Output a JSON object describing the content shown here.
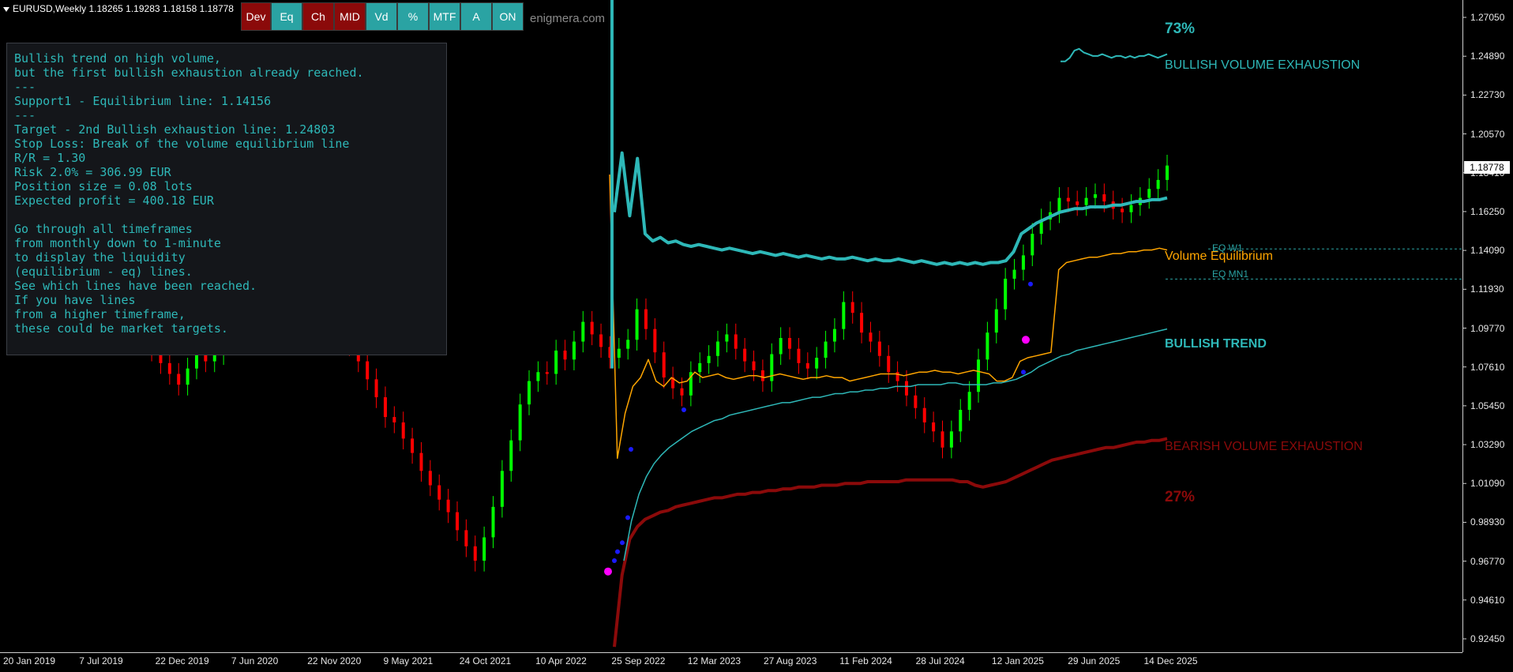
{
  "header": {
    "title": "EURUSD,Weekly  1.18265 1.19283 1.18158 1.18778"
  },
  "toolbar": {
    "buttons": [
      {
        "label": "Dev",
        "style": "red"
      },
      {
        "label": "Eq",
        "style": "teal"
      },
      {
        "label": "Ch",
        "style": "red"
      },
      {
        "label": "MID",
        "style": "red"
      },
      {
        "label": "Vd",
        "style": "teal"
      },
      {
        "label": "%",
        "style": "teal"
      },
      {
        "label": "MTF",
        "style": "teal"
      },
      {
        "label": "A",
        "style": "teal"
      },
      {
        "label": "ON",
        "style": "teal"
      }
    ],
    "site": "enigmera.com"
  },
  "info_panel": {
    "lines": [
      "Bullish trend on high volume,",
      "but the first bullish exhaustion already reached.",
      "---",
      "Support1 - Equilibrium line: 1.14156",
      "---",
      "Target - 2nd Bullish exhaustion line: 1.24803",
      "Stop Loss: Break of the volume equilibrium line",
      "R/R = 1.30",
      "Risk 2.0% = 306.99 EUR",
      "Position size = 0.08 lots",
      "Expected profit = 400.18 EUR",
      "",
      "Go through all timeframes",
      "from monthly down to 1-minute",
      "to display the liquidity",
      "(equilibrium - eq) lines.",
      "See which lines have been reached.",
      "If you have lines",
      "from a higher timeframe,",
      "these could be market targets."
    ]
  },
  "labels": {
    "bull_pct": "73%",
    "bull_exhaustion": "BULLISH VOLUME EXHAUSTION",
    "eq_w1": "EQ W1",
    "volume_equilibrium": "Volume Equilibrium",
    "eq_mn1": "EQ MN1",
    "bullish_trend": "BULLISH TREND",
    "bear_exhaustion": "BEARISH VOLUME EXHAUSTION",
    "bear_pct": "27%"
  },
  "current_price": "1.18778",
  "colors": {
    "background": "#000000",
    "teal": "#2eb8b8",
    "orange": "#ffa500",
    "dark_red": "#8b0a0a",
    "candle_up": "#00ff00",
    "candle_down": "#ff0000",
    "magenta": "#ff00ff",
    "blue_dot": "#1a1aff"
  },
  "chart_data": {
    "type": "line",
    "title": "EURUSD,Weekly",
    "ylim": [
      0.915,
      1.285
    ],
    "y_ticks": [
      "1.27050",
      "1.24890",
      "1.22730",
      "1.20570",
      "1.18410",
      "1.16250",
      "1.14090",
      "1.11930",
      "1.09770",
      "1.07610",
      "1.05450",
      "1.03290",
      "1.01090",
      "0.98930",
      "0.96770",
      "0.94610",
      "0.92450"
    ],
    "x_ticks": [
      "20 Jan 2019",
      "7 Jul 2019",
      "22 Dec 2019",
      "7 Jun 2020",
      "22 Nov 2020",
      "9 May 2021",
      "24 Oct 2021",
      "10 Apr 2022",
      "25 Sep 2022",
      "12 Mar 2023",
      "27 Aug 2023",
      "11 Feb 2024",
      "28 Jul 2024",
      "12 Jan 2025",
      "29 Jun 2025",
      "14 Dec 2025"
    ],
    "series": [
      {
        "name": "BULLISH VOLUME EXHAUSTION",
        "color": "#2eb8b8",
        "values": [
          1.162,
          1.195,
          1.16,
          1.192,
          1.15,
          1.146,
          1.148,
          1.145,
          1.146,
          1.144,
          1.143,
          1.144,
          1.143,
          1.142,
          1.141,
          1.142,
          1.141,
          1.14,
          1.139,
          1.14,
          1.139,
          1.138,
          1.139,
          1.138,
          1.137,
          1.138,
          1.137,
          1.136,
          1.137,
          1.136,
          1.136,
          1.137,
          1.136,
          1.135,
          1.136,
          1.135,
          1.135,
          1.136,
          1.135,
          1.134,
          1.135,
          1.134,
          1.133,
          1.134,
          1.133,
          1.134,
          1.133,
          1.134,
          1.133,
          1.134,
          1.134,
          1.135,
          1.14,
          1.15,
          1.153,
          1.156,
          1.158,
          1.16,
          1.162,
          1.163,
          1.164,
          1.164,
          1.165,
          1.165,
          1.165,
          1.166,
          1.166,
          1.167,
          1.168,
          1.168,
          1.169,
          1.169,
          1.17
        ]
      },
      {
        "name": "Volume Equilibrium",
        "color": "#ffa500",
        "values": [
          1.183,
          1.025,
          1.05,
          1.065,
          1.07,
          1.08,
          1.068,
          1.065,
          1.07,
          1.067,
          1.068,
          1.073,
          1.07,
          1.071,
          1.072,
          1.07,
          1.069,
          1.07,
          1.071,
          1.071,
          1.07,
          1.071,
          1.072,
          1.071,
          1.07,
          1.069,
          1.07,
          1.07,
          1.071,
          1.07,
          1.07,
          1.068,
          1.069,
          1.07,
          1.071,
          1.072,
          1.072,
          1.072,
          1.071,
          1.072,
          1.073,
          1.073,
          1.074,
          1.073,
          1.073,
          1.072,
          1.073,
          1.074,
          1.073,
          1.072,
          1.068,
          1.068,
          1.07,
          1.079,
          1.081,
          1.082,
          1.083,
          1.084,
          1.13,
          1.134,
          1.135,
          1.136,
          1.137,
          1.137,
          1.138,
          1.139,
          1.139,
          1.14,
          1.14,
          1.141,
          1.141,
          1.142,
          1.141
        ]
      },
      {
        "name": "BULLISH TREND",
        "color": "#2eb8b8",
        "values": [
          0.968,
          0.99,
          1.005,
          1.015,
          1.022,
          1.027,
          1.031,
          1.034,
          1.037,
          1.04,
          1.042,
          1.044,
          1.046,
          1.047,
          1.049,
          1.05,
          1.051,
          1.052,
          1.053,
          1.054,
          1.055,
          1.056,
          1.056,
          1.057,
          1.058,
          1.059,
          1.059,
          1.06,
          1.061,
          1.061,
          1.062,
          1.062,
          1.063,
          1.063,
          1.064,
          1.064,
          1.065,
          1.065,
          1.065,
          1.066,
          1.066,
          1.066,
          1.066,
          1.067,
          1.067,
          1.066,
          1.066,
          1.066,
          1.066,
          1.067,
          1.067,
          1.068,
          1.069,
          1.071,
          1.073,
          1.076,
          1.078,
          1.08,
          1.082,
          1.083,
          1.085,
          1.086,
          1.087,
          1.088,
          1.089,
          1.09,
          1.091,
          1.092,
          1.093,
          1.094,
          1.095,
          1.096,
          1.097
        ]
      },
      {
        "name": "BEARISH VOLUME EXHAUSTION",
        "color": "#8b0a0a",
        "values": [
          0.92,
          0.96,
          0.98,
          0.987,
          0.991,
          0.993,
          0.995,
          0.996,
          0.998,
          0.999,
          1.0,
          1.001,
          1.002,
          1.003,
          1.003,
          1.004,
          1.005,
          1.005,
          1.006,
          1.006,
          1.007,
          1.007,
          1.008,
          1.008,
          1.009,
          1.009,
          1.009,
          1.01,
          1.01,
          1.01,
          1.011,
          1.011,
          1.011,
          1.012,
          1.012,
          1.012,
          1.012,
          1.012,
          1.013,
          1.013,
          1.013,
          1.013,
          1.013,
          1.013,
          1.013,
          1.012,
          1.012,
          1.01,
          1.009,
          1.01,
          1.011,
          1.012,
          1.014,
          1.016,
          1.018,
          1.02,
          1.022,
          1.024,
          1.025,
          1.026,
          1.027,
          1.028,
          1.029,
          1.03,
          1.031,
          1.031,
          1.032,
          1.033,
          1.034,
          1.034,
          1.035,
          1.035,
          1.036
        ]
      },
      {
        "name": "BULLISH VOLUME EXHAUSTION 2",
        "color": "#2eb8b8",
        "values": [
          1.246,
          1.246,
          1.248,
          1.252,
          1.253,
          1.251,
          1.25,
          1.249,
          1.249,
          1.25,
          1.249,
          1.248,
          1.249,
          1.249,
          1.248,
          1.249,
          1.248,
          1.249,
          1.249,
          1.25,
          1.249,
          1.248,
          1.249,
          1.25
        ]
      },
      {
        "name": "Price",
        "color": "#00ff00",
        "values": [
          1.138,
          1.132,
          1.125,
          1.118,
          1.11,
          1.102,
          1.113,
          1.121,
          1.128,
          1.12,
          1.112,
          1.108,
          1.1,
          1.09,
          1.097,
          1.089,
          1.085,
          1.078,
          1.072,
          1.066,
          1.075,
          1.088,
          1.079,
          1.083,
          1.15,
          1.16,
          1.153,
          1.145,
          1.138,
          1.13,
          1.136,
          1.143,
          1.135,
          1.128,
          1.121,
          1.114,
          1.106,
          1.097,
          1.088,
          1.079,
          1.069,
          1.059,
          1.048,
          1.045,
          1.036,
          1.028,
          1.018,
          1.01,
          1.002,
          0.995,
          0.985,
          0.976,
          0.968,
          0.981,
          0.998,
          1.018,
          1.035,
          1.055,
          1.068,
          1.073,
          1.072,
          1.085,
          1.08,
          1.09,
          1.101,
          1.094,
          1.087,
          1.081,
          1.086,
          1.091,
          1.108,
          1.097,
          1.084,
          1.07,
          1.064,
          1.06,
          1.073,
          1.078,
          1.082,
          1.09,
          1.094,
          1.086,
          1.079,
          1.074,
          1.068,
          1.083,
          1.092,
          1.086,
          1.078,
          1.075,
          1.081,
          1.09,
          1.097,
          1.112,
          1.106,
          1.095,
          1.09,
          1.082,
          1.073,
          1.068,
          1.06,
          1.053,
          1.045,
          1.04,
          1.031,
          1.04,
          1.052,
          1.062,
          1.08,
          1.095,
          1.108,
          1.125,
          1.13,
          1.138,
          1.15,
          1.158,
          1.162,
          1.17,
          1.168,
          1.166,
          1.17,
          1.172,
          1.168,
          1.164,
          1.162,
          1.166,
          1.17,
          1.175,
          1.18,
          1.188
        ]
      }
    ]
  }
}
